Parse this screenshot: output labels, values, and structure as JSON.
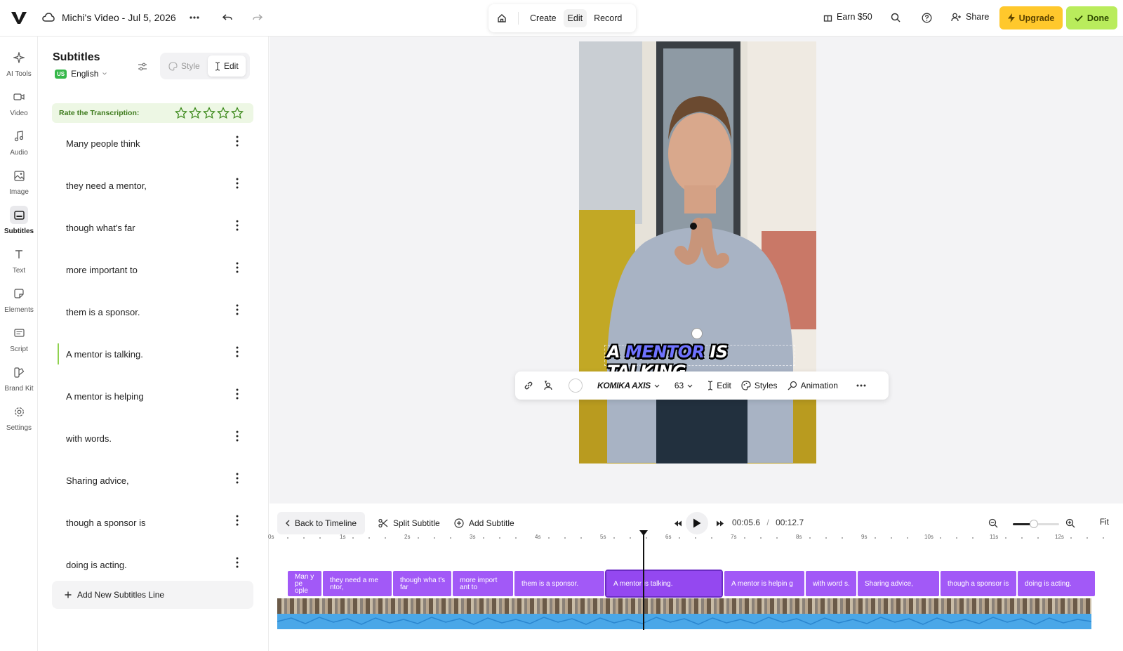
{
  "project": {
    "title": "Michi's Video - Jul 5, 2026"
  },
  "top_modes": [
    {
      "label": "Create"
    },
    {
      "label": "Edit"
    },
    {
      "label": "Record"
    }
  ],
  "top_right": {
    "earn": "Earn $50",
    "share": "Share",
    "upgrade": "Upgrade",
    "done": "Done"
  },
  "rail": [
    {
      "label": "AI Tools",
      "icon": "sparkle-icon"
    },
    {
      "label": "Video",
      "icon": "video-icon"
    },
    {
      "label": "Audio",
      "icon": "music-icon"
    },
    {
      "label": "Image",
      "icon": "image-icon"
    },
    {
      "label": "Subtitles",
      "icon": "subtitles-icon",
      "active": true
    },
    {
      "label": "Text",
      "icon": "text-icon"
    },
    {
      "label": "Elements",
      "icon": "elements-icon"
    },
    {
      "label": "Script",
      "icon": "script-icon"
    },
    {
      "label": "Brand Kit",
      "icon": "brand-kit-icon"
    },
    {
      "label": "Settings",
      "icon": "gear-icon"
    }
  ],
  "panel": {
    "title": "Subtitles",
    "lang_badge": "US",
    "language": "English",
    "tab_style": "Style",
    "tab_edit": "Edit",
    "rate_label": "Rate the Transcription:",
    "rating_stars": 5,
    "add_line": "Add New Subtitles Line"
  },
  "subtitles": [
    {
      "text": "Many people think"
    },
    {
      "text": "they need a mentor,"
    },
    {
      "text": "though what's far"
    },
    {
      "text": "more important to"
    },
    {
      "text": "them is a sponsor."
    },
    {
      "text": "A mentor is talking.",
      "active": true
    },
    {
      "text": "A mentor is helping"
    },
    {
      "text": "with words."
    },
    {
      "text": "Sharing advice,"
    },
    {
      "text": "though a sponsor is"
    },
    {
      "text": "doing is acting."
    }
  ],
  "caption": {
    "pre": "A ",
    "highlight": "MENTOR",
    "post": " IS TALKING."
  },
  "text_toolbar": {
    "font": "KOMIKA AXIS",
    "size": "63",
    "edit": "Edit",
    "styles": "Styles",
    "animation": "Animation"
  },
  "timeline": {
    "back": "Back to Timeline",
    "split": "Split Subtitle",
    "add": "Add Subtitle",
    "current_time": "00:05.6",
    "separator": "/",
    "total_time": "00:12.7",
    "fit": "Fit",
    "zoom_level": 0.45,
    "ticks": [
      "0s",
      "1s",
      "2s",
      "3s",
      "4s",
      "5s",
      "6s",
      "7s",
      "8s",
      "9s",
      "10s",
      "11s",
      "12s"
    ],
    "clips": [
      {
        "text": "Man y pe ople"
      },
      {
        "text": "they need a me ntor,"
      },
      {
        "text": "though wha t's far"
      },
      {
        "text": "more import ant to"
      },
      {
        "text": "them is a sponsor."
      },
      {
        "text": "A mentor is talking.",
        "selected": true
      },
      {
        "text": "A mentor is helpin g"
      },
      {
        "text": "with word s."
      },
      {
        "text": "Sharing advice,"
      },
      {
        "text": "though a sponsor is"
      },
      {
        "text": "doing is acting."
      }
    ]
  },
  "colors": {
    "accent_purple": "#a259f7",
    "upgrade_yellow": "#ffc82c",
    "done_green": "#b9ec5c"
  }
}
